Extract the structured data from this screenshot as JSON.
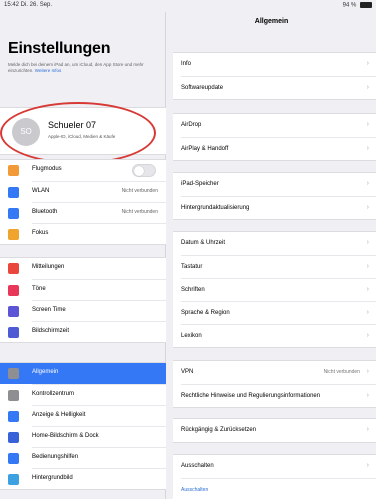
{
  "status": {
    "left": "15:42  Di. 26. Sep.",
    "right": "94 %"
  },
  "sidebar": {
    "title": "Einstellungen",
    "description": "Melde dich bei deinem iPad an, um iCloud, den App Store und mehr einzurichten.",
    "description_link": "Weitere Infos",
    "profile": {
      "avatar_initials": "SO",
      "name": "Schueler 07",
      "subtitle": "Apple-ID, iCloud, Medien & Käufe"
    },
    "groups": [
      {
        "items": [
          {
            "label": "Flugmodus",
            "icon": "airplane-icon",
            "color": "#f19a37",
            "toggle": true
          },
          {
            "label": "WLAN",
            "icon": "wifi-icon",
            "color": "#3478f6",
            "value": "Nicht verbunden"
          },
          {
            "label": "Bluetooth",
            "icon": "bluetooth-icon",
            "color": "#3478f6",
            "value": "Nicht verbunden"
          },
          {
            "label": "Fokus",
            "icon": "focus-icon",
            "color": "#f0a32d"
          }
        ]
      },
      {
        "items": [
          {
            "label": "Mitteilungen",
            "icon": "notifications-icon",
            "color": "#e9463d"
          },
          {
            "label": "Töne",
            "icon": "sounds-icon",
            "color": "#e9375a"
          },
          {
            "label": "Screen Time",
            "icon": "hourglass-icon",
            "color": "#5c55d6"
          },
          {
            "label": "Bildschirmzeit",
            "icon": "screen-time-icon",
            "color": "#4e5bd4"
          }
        ]
      },
      {
        "items": [
          {
            "label": "Allgemein",
            "icon": "gear-icon",
            "color": "#8e8e93",
            "selected": true
          },
          {
            "label": "Kontrollzentrum",
            "icon": "control-center-icon",
            "color": "#8e8e93"
          },
          {
            "label": "Anzeige & Helligkeit",
            "icon": "display-icon",
            "color": "#3478f6"
          },
          {
            "label": "Home-Bildschirm & Dock",
            "icon": "home-screen-icon",
            "color": "#3a62d8"
          },
          {
            "label": "Bedienungshilfen",
            "icon": "accessibility-icon",
            "color": "#3478f6"
          },
          {
            "label": "Hintergrundbild",
            "icon": "wallpaper-icon",
            "color": "#3ca1e0"
          }
        ]
      }
    ]
  },
  "detail": {
    "title": "Allgemein",
    "groups": [
      {
        "items": [
          {
            "label": "Info"
          },
          {
            "label": "Softwareupdate"
          }
        ]
      },
      {
        "items": [
          {
            "label": "AirDrop"
          },
          {
            "label": "AirPlay & Handoff"
          }
        ]
      },
      {
        "items": [
          {
            "label": "iPad-Speicher"
          },
          {
            "label": "Hintergrundaktualisierung"
          }
        ]
      },
      {
        "items": [
          {
            "label": "Datum & Uhrzeit"
          },
          {
            "label": "Tastatur"
          },
          {
            "label": "Schriften"
          },
          {
            "label": "Sprache & Region"
          },
          {
            "label": "Lexikon"
          }
        ]
      },
      {
        "items": [
          {
            "label": "VPN",
            "value": "Nicht verbunden"
          },
          {
            "label": "Rechtliche Hinweise und Regulierungsinformationen"
          }
        ]
      },
      {
        "items": [
          {
            "label": "Rückgängig & Zurücksetzen"
          }
        ]
      },
      {
        "items": [
          {
            "label": "Ausschalten"
          },
          {
            "label": "Ausschalten",
            "link": true
          }
        ]
      }
    ]
  }
}
